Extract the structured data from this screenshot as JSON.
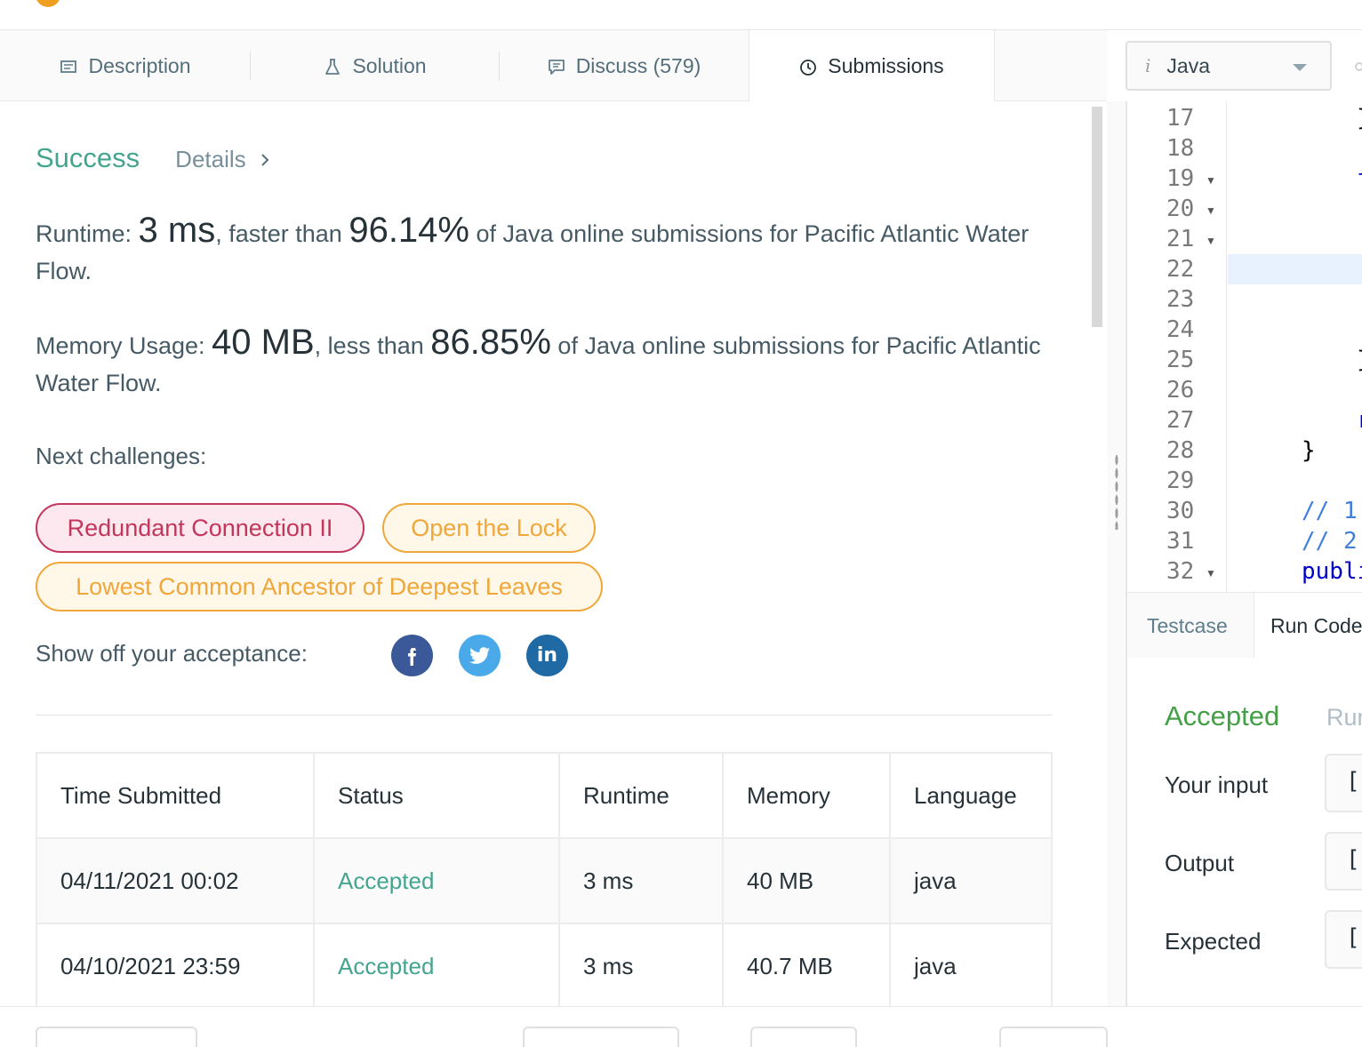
{
  "tabs": [
    {
      "label": "Description",
      "icon": "description-icon"
    },
    {
      "label": "Solution",
      "icon": "flask-icon"
    },
    {
      "label": "Discuss (579)",
      "icon": "discuss-icon"
    },
    {
      "label": "Submissions",
      "icon": "clock-icon",
      "active": true
    }
  ],
  "result": {
    "status": "Success",
    "details_label": "Details",
    "runtime_label": "Runtime: ",
    "runtime_value": "3 ms",
    "runtime_mid": ", faster than ",
    "runtime_pct": "96.14%",
    "runtime_tail": " of Java online submissions for Pacific Atlantic Water Flow.",
    "memory_label": "Memory Usage: ",
    "memory_value": "40 MB",
    "memory_mid": ", less than ",
    "memory_pct": "86.85%",
    "memory_tail": " of Java online submissions for Pacific Atlantic Water Flow."
  },
  "next": {
    "label": "Next challenges:",
    "items": [
      {
        "title": "Redundant Connection II",
        "difficulty": "hard"
      },
      {
        "title": "Open the Lock",
        "difficulty": "medium"
      },
      {
        "title": "Lowest Common Ancestor of Deepest Leaves",
        "difficulty": "medium"
      }
    ]
  },
  "share": {
    "label": "Show off your acceptance:",
    "networks": [
      {
        "name": "facebook-icon",
        "glyph": "f",
        "color": "#3b5998"
      },
      {
        "name": "twitter-icon",
        "glyph": "t",
        "color": "#4aa9e9"
      },
      {
        "name": "linkedin-icon",
        "glyph": "in",
        "color": "#1f6aa5"
      }
    ]
  },
  "table": {
    "headers": [
      "Time Submitted",
      "Status",
      "Runtime",
      "Memory",
      "Language"
    ],
    "rows": [
      [
        "04/11/2021 00:02",
        "Accepted",
        "3 ms",
        "40 MB",
        "java"
      ],
      [
        "04/10/2021 23:59",
        "Accepted",
        "3 ms",
        "40.7 MB",
        "java"
      ]
    ]
  },
  "editor": {
    "language": "Java",
    "line_numbers": [
      "17",
      "18",
      "19",
      "20",
      "21",
      "22",
      "23",
      "24",
      "25",
      "26",
      "27",
      "28",
      "29",
      "30",
      "31",
      "32"
    ],
    "folds": [
      "19",
      "20",
      "21",
      "32"
    ],
    "code": [
      {
        "line": "17",
        "text": "}",
        "color": "#000000"
      },
      {
        "line": "19",
        "text": "f",
        "color": "#0000cc"
      },
      {
        "line": "25",
        "text": "}",
        "color": "#000000"
      },
      {
        "line": "27",
        "text": "r",
        "color": "#0000cc"
      },
      {
        "line": "28",
        "text": "}",
        "color": "#000000"
      },
      {
        "line": "30",
        "text": "// 1:",
        "color": "#3f7fdd"
      },
      {
        "line": "31",
        "text": "// 2:",
        "color": "#3f7fdd"
      },
      {
        "line": "32",
        "text": "publi",
        "color": "#0000cc"
      }
    ]
  },
  "console": {
    "tabs": [
      "Testcase",
      "Run Code"
    ],
    "status": "Accepted",
    "runtime_partial": "Run",
    "rows": [
      {
        "label": "Your input",
        "value": "[["
      },
      {
        "label": "Output",
        "value": "[["
      },
      {
        "label": "Expected",
        "value": "[["
      }
    ]
  },
  "colors": {
    "accent": "#43a58f",
    "hard": "#c2365d",
    "medium": "#f0a73a",
    "accepted_green": "#43a047"
  }
}
